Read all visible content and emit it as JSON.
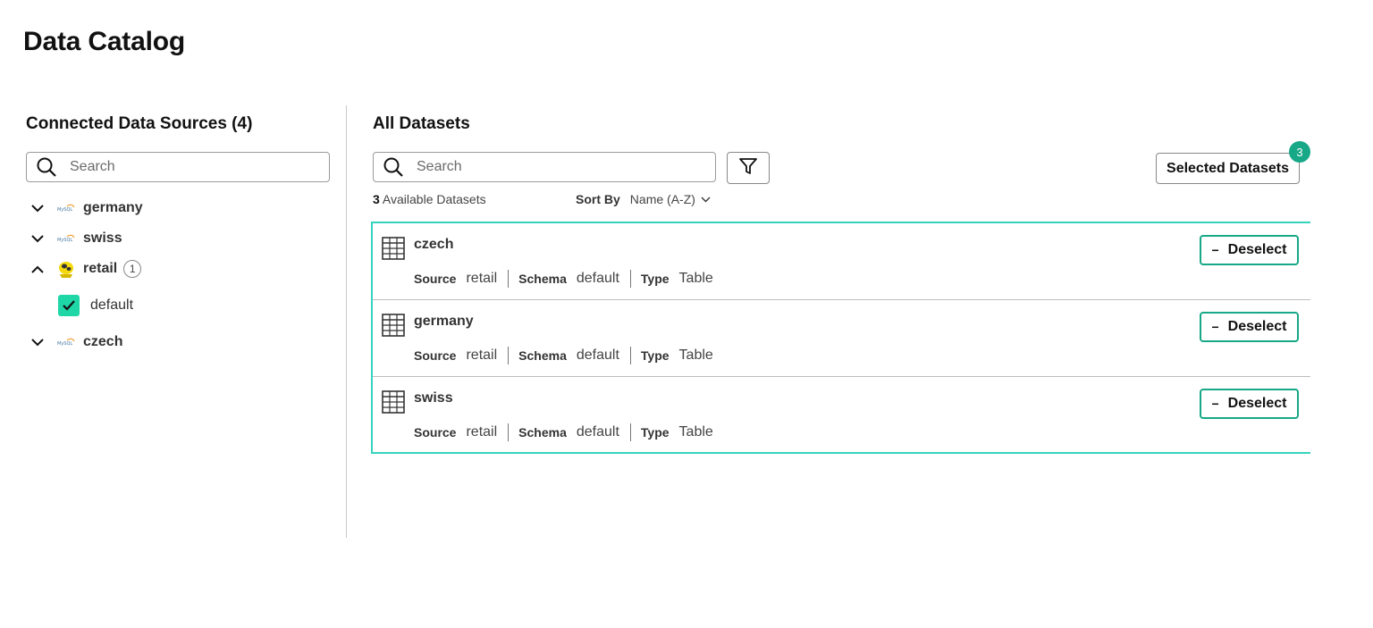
{
  "page": {
    "title": "Data Catalog"
  },
  "sources": {
    "title": "Connected Data Sources (4)",
    "search_placeholder": "Search",
    "items": [
      {
        "label": "germany",
        "icon": "mysql-icon",
        "expanded": false
      },
      {
        "label": "swiss",
        "icon": "mysql-icon",
        "expanded": false
      },
      {
        "label": "retail",
        "icon": "hive-icon",
        "expanded": true,
        "count": "1",
        "children": [
          {
            "label": "default",
            "checked": true
          }
        ]
      },
      {
        "label": "czech",
        "icon": "mysql-icon",
        "expanded": false
      }
    ]
  },
  "datasets": {
    "title": "All Datasets",
    "search_placeholder": "Search",
    "available_count": "3",
    "available_label": " Available Datasets",
    "sort_label": "Sort By",
    "sort_value": "Name (A-Z)",
    "selected_button": "Selected Datasets",
    "selected_count": "3",
    "meta_labels": {
      "source": "Source",
      "schema": "Schema",
      "type": "Type"
    },
    "deselect_label": "Deselect",
    "rows": [
      {
        "name": "czech",
        "source": "retail",
        "schema": "default",
        "type": "Table"
      },
      {
        "name": "germany",
        "source": "retail",
        "schema": "default",
        "type": "Table"
      },
      {
        "name": "swiss",
        "source": "retail",
        "schema": "default",
        "type": "Table"
      }
    ]
  },
  "colors": {
    "accent": "#17a887",
    "checkbox": "#1fd6a6",
    "selection_border": "#35d3be"
  }
}
